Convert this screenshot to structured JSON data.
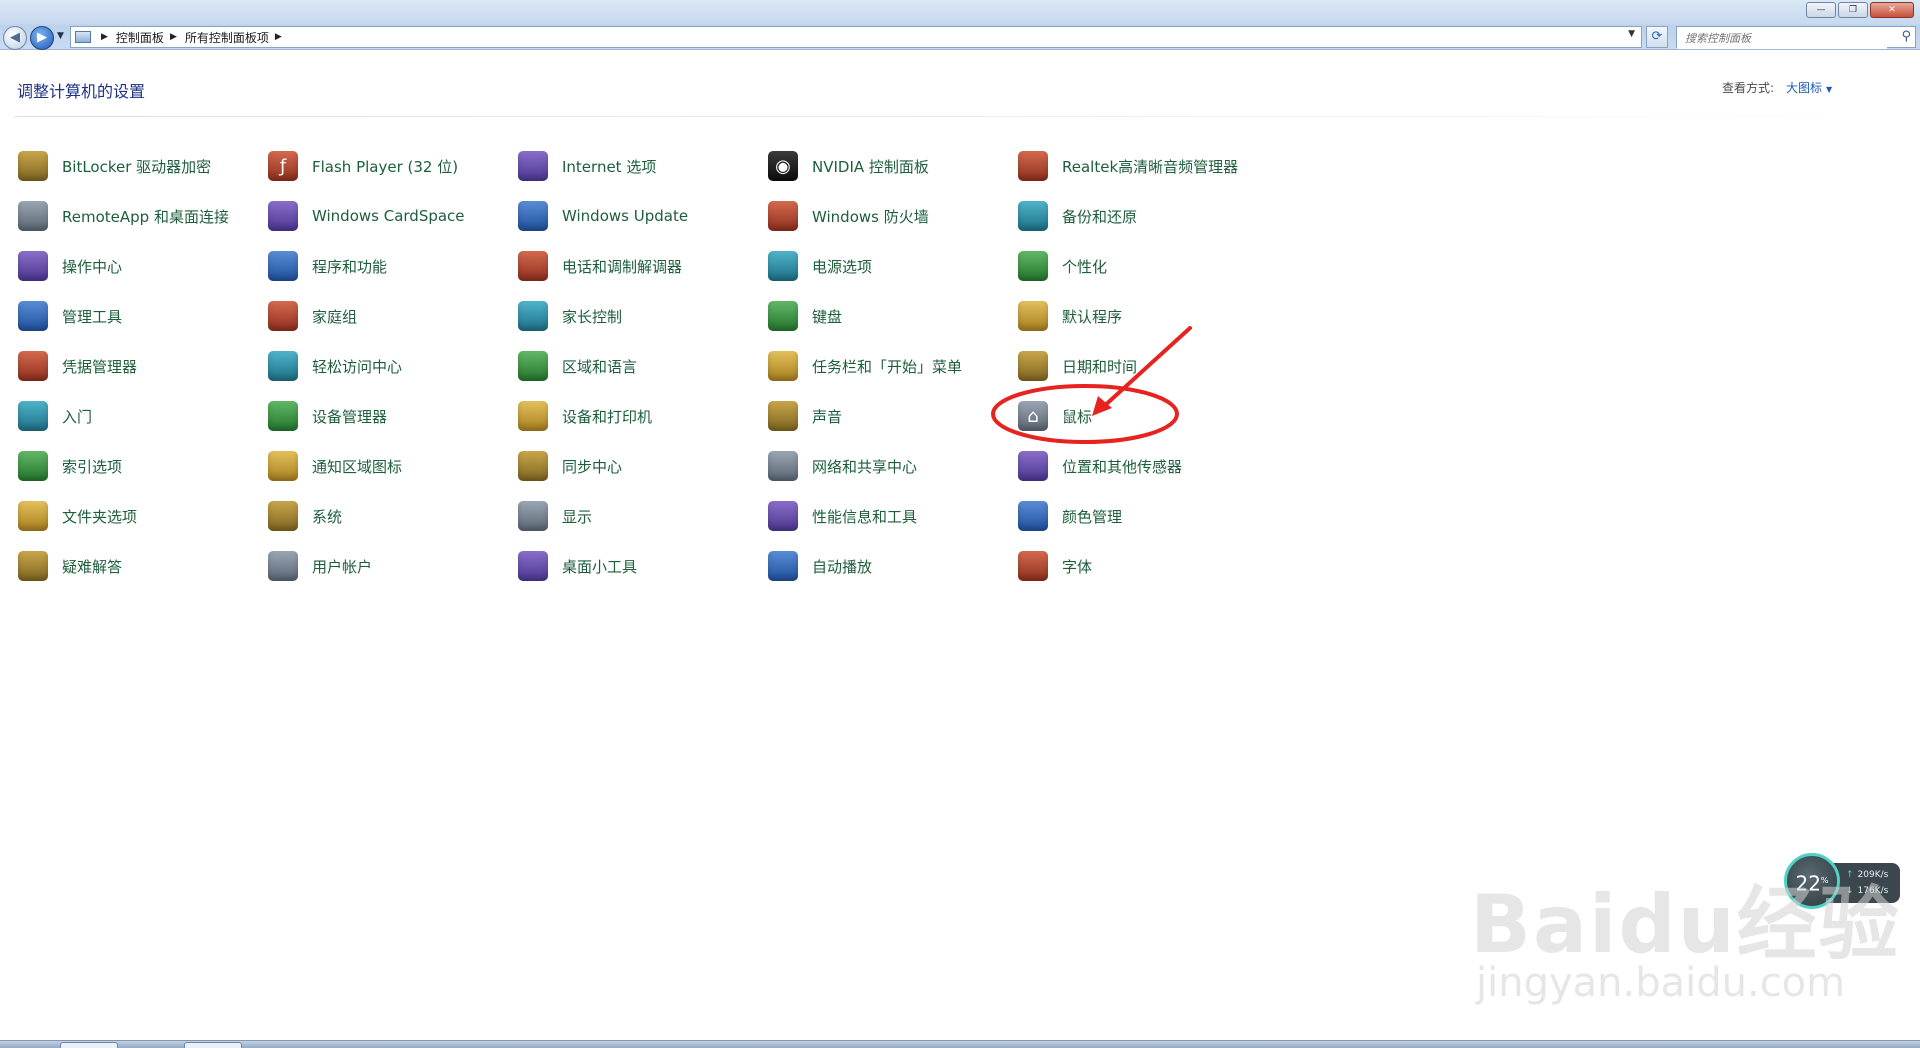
{
  "window": {
    "controls": {
      "minimize": "—",
      "restore": "❐",
      "close": "✕"
    }
  },
  "address": {
    "crumbs": [
      "控制面板",
      "所有控制面板项"
    ],
    "search_placeholder": "搜索控制面板"
  },
  "header": {
    "title": "调整计算机的设置",
    "view_label": "查看方式:",
    "view_value": "大图标"
  },
  "items": [
    {
      "label": "BitLocker 驱动器加密",
      "icon": "bitlocker-icon"
    },
    {
      "label": "RemoteApp 和桌面连接",
      "icon": "remoteapp-icon"
    },
    {
      "label": "操作中心",
      "icon": "action-center-icon"
    },
    {
      "label": "管理工具",
      "icon": "admin-tools-icon"
    },
    {
      "label": "凭据管理器",
      "icon": "credential-manager-icon"
    },
    {
      "label": "入门",
      "icon": "getting-started-icon"
    },
    {
      "label": "索引选项",
      "icon": "indexing-icon"
    },
    {
      "label": "文件夹选项",
      "icon": "folder-options-icon"
    },
    {
      "label": "疑难解答",
      "icon": "troubleshooting-icon"
    },
    {
      "label": "Flash Player (32 位)",
      "icon": "flash-player-icon"
    },
    {
      "label": "Windows CardSpace",
      "icon": "cardspace-icon"
    },
    {
      "label": "程序和功能",
      "icon": "programs-icon"
    },
    {
      "label": "家庭组",
      "icon": "homegroup-icon"
    },
    {
      "label": "轻松访问中心",
      "icon": "ease-of-access-icon"
    },
    {
      "label": "设备管理器",
      "icon": "device-manager-icon"
    },
    {
      "label": "通知区域图标",
      "icon": "notification-icons-icon"
    },
    {
      "label": "系统",
      "icon": "system-icon"
    },
    {
      "label": "用户帐户",
      "icon": "user-accounts-icon"
    },
    {
      "label": "Internet 选项",
      "icon": "internet-options-icon"
    },
    {
      "label": "Windows Update",
      "icon": "windows-update-icon"
    },
    {
      "label": "电话和调制解调器",
      "icon": "phone-modem-icon"
    },
    {
      "label": "家长控制",
      "icon": "parental-controls-icon"
    },
    {
      "label": "区域和语言",
      "icon": "region-language-icon"
    },
    {
      "label": "设备和打印机",
      "icon": "devices-printers-icon"
    },
    {
      "label": "同步中心",
      "icon": "sync-center-icon"
    },
    {
      "label": "显示",
      "icon": "display-icon"
    },
    {
      "label": "桌面小工具",
      "icon": "gadgets-icon"
    },
    {
      "label": "NVIDIA 控制面板",
      "icon": "nvidia-icon"
    },
    {
      "label": "Windows 防火墙",
      "icon": "firewall-icon"
    },
    {
      "label": "电源选项",
      "icon": "power-options-icon"
    },
    {
      "label": "键盘",
      "icon": "keyboard-icon"
    },
    {
      "label": "任务栏和「开始」菜单",
      "icon": "taskbar-start-icon"
    },
    {
      "label": "声音",
      "icon": "sound-icon"
    },
    {
      "label": "网络和共享中心",
      "icon": "network-sharing-icon"
    },
    {
      "label": "性能信息和工具",
      "icon": "performance-icon"
    },
    {
      "label": "自动播放",
      "icon": "autoplay-icon"
    },
    {
      "label": "Realtek高清晰音频管理器",
      "icon": "realtek-audio-icon"
    },
    {
      "label": "备份和还原",
      "icon": "backup-restore-icon"
    },
    {
      "label": "个性化",
      "icon": "personalization-icon"
    },
    {
      "label": "默认程序",
      "icon": "default-programs-icon"
    },
    {
      "label": "日期和时间",
      "icon": "date-time-icon"
    },
    {
      "label": "鼠标",
      "icon": "mouse-icon"
    },
    {
      "label": "位置和其他传感器",
      "icon": "location-sensors-icon"
    },
    {
      "label": "颜色管理",
      "icon": "color-management-icon"
    },
    {
      "label": "字体",
      "icon": "fonts-icon"
    }
  ],
  "net_widget": {
    "percent": "22",
    "percent_unit": "%",
    "up": "209K/s",
    "down": "176K/s"
  },
  "watermark": {
    "logo": "Baidu经验",
    "url": "jingyan.baidu.com"
  },
  "colors": {
    "link": "#1d5e3b",
    "title": "#1e3287",
    "annotation": "#e8231f"
  }
}
